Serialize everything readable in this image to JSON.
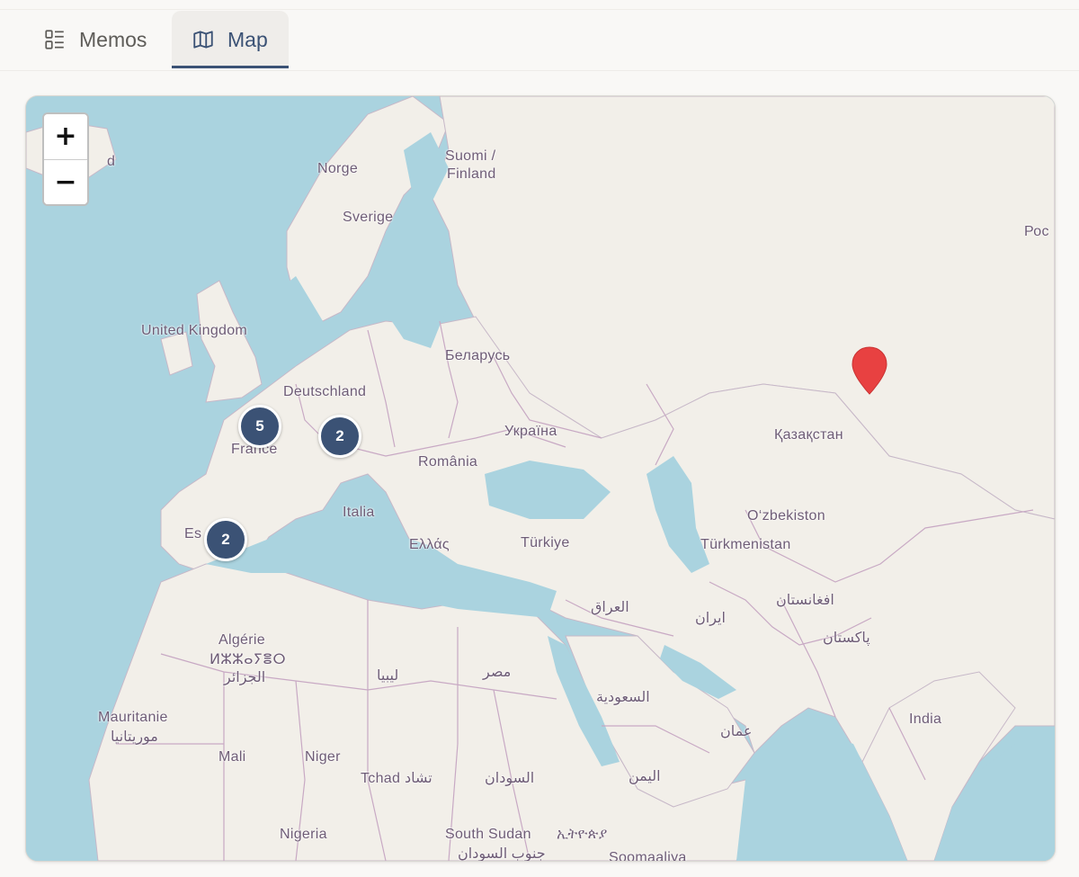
{
  "tabs": [
    {
      "label": "Memos",
      "icon": "list-icon",
      "active": false
    },
    {
      "label": "Map",
      "icon": "map-icon",
      "active": true
    }
  ],
  "map": {
    "zoom_in_label": "+",
    "zoom_out_label": "−",
    "labels": {
      "island": "d",
      "norge": "Norge",
      "finland_1": "Suomi /",
      "finland_2": "Finland",
      "sverige": "Sverige",
      "russia": "Рос",
      "uk": "United Kingdom",
      "belarus": "Беларусь",
      "deutschland": "Deutschland",
      "france": "France",
      "ukraine": "Україна",
      "kazakhstan": "Қазақстан",
      "romania": "România",
      "italia": "Italia",
      "espana": "Es",
      "ellas": "Ελλάς",
      "turkiye": "Türkiye",
      "uzbekistan": "O‘zbekiston",
      "turkmenistan": "Türkmenistan",
      "iraq": "العراق",
      "iran": "ایران",
      "afghanistan": "افغانستان",
      "pakistan": "پاکستان",
      "algeria_1": "Algérie",
      "algeria_2": "ⵍⵣⵣⴰⵢⴻⵔ",
      "algeria_3": "الجزائر",
      "libya": "ليبيا",
      "egypt": "مصر",
      "saudi": "السعودية",
      "oman": "عمان",
      "india": "India",
      "mauritania_1": "Mauritanie",
      "mauritania_2": "موريتانيا",
      "mali": "Mali",
      "niger": "Niger",
      "chad": "Tchad تشاد",
      "sudan": "السودان",
      "yemen": "اليمن",
      "nigeria": "Nigeria",
      "south_sudan_1": "South Sudan",
      "south_sudan_2": "جنوب السودان",
      "ethiopia": "ኢትዮጵያ",
      "somalia": "Soomaaliya"
    },
    "clusters": [
      {
        "count": "5",
        "place": "France"
      },
      {
        "count": "2",
        "place": "Switzerland"
      },
      {
        "count": "2",
        "place": "Spain"
      }
    ],
    "marker": {
      "place": "Kazakhstan",
      "color": "#e84141"
    }
  },
  "colors": {
    "accent": "#3b5275",
    "water": "#aad3df",
    "land": "#f2efe9",
    "marker": "#e84141"
  }
}
